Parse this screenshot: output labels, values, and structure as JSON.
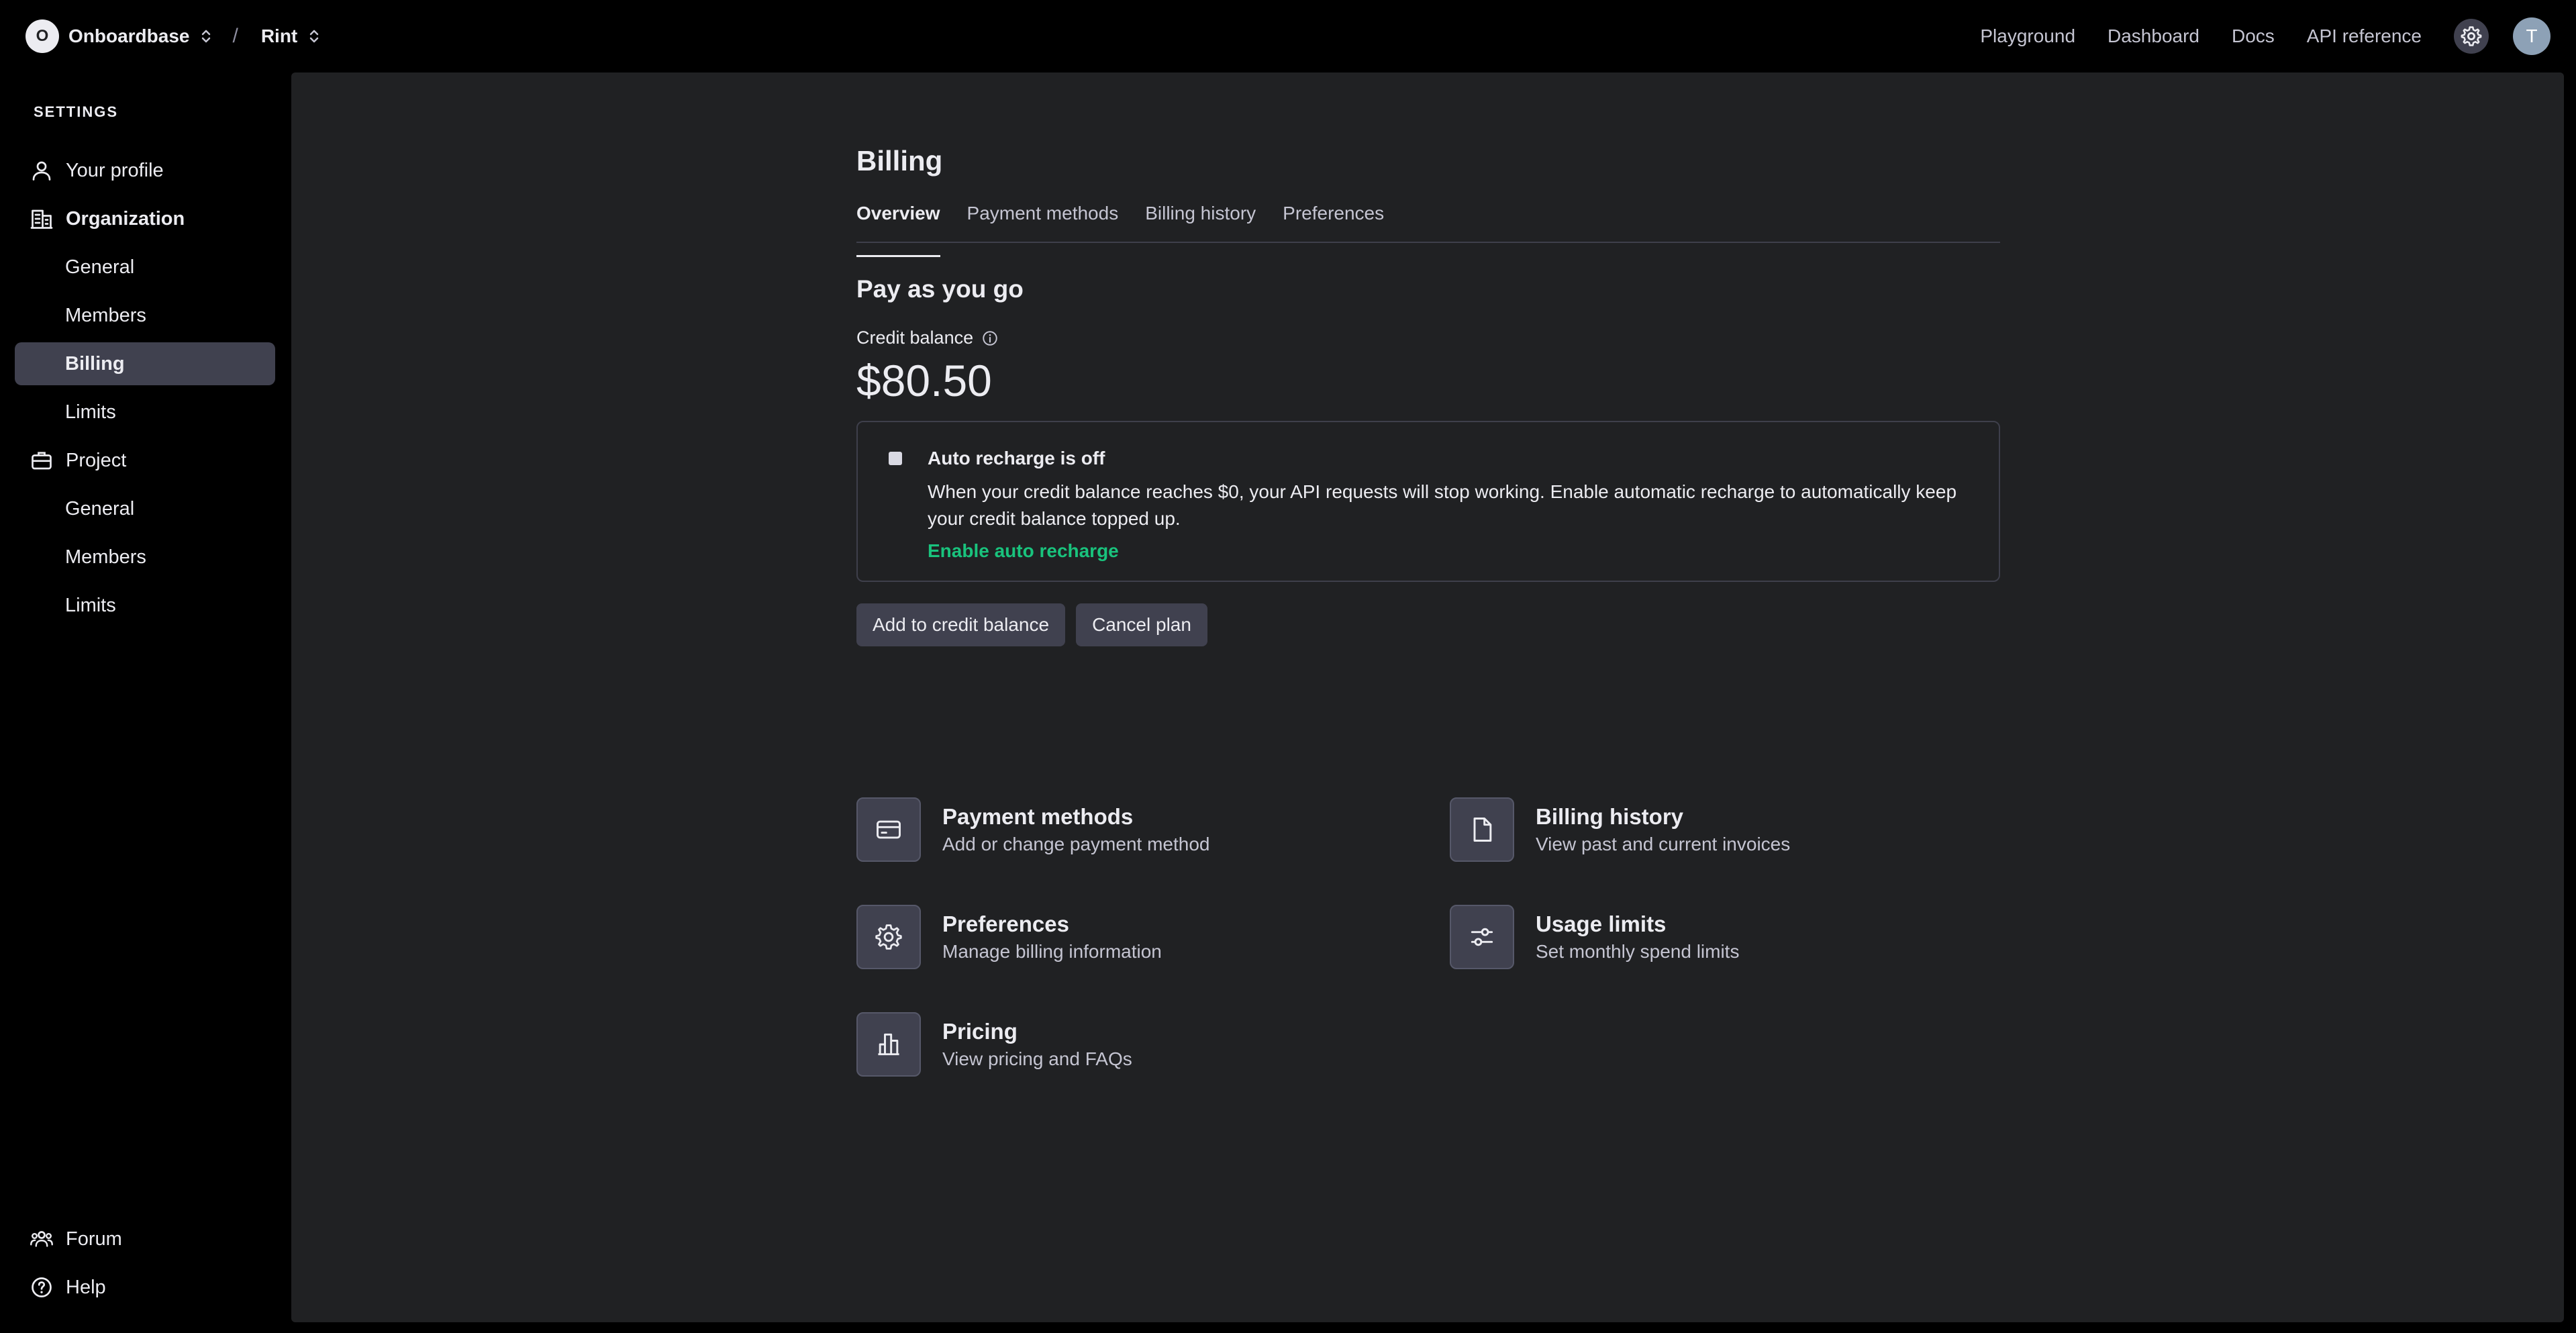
{
  "topbar": {
    "org_initial": "O",
    "org_name": "Onboardbase",
    "separator": "/",
    "project_name": "Rint",
    "nav": [
      "Playground",
      "Dashboard",
      "Docs",
      "API reference"
    ],
    "user_initial": "T"
  },
  "sidebar": {
    "heading": "SETTINGS",
    "your_profile": "Your profile",
    "organization": "Organization",
    "org_items": [
      "General",
      "Members",
      "Billing",
      "Limits"
    ],
    "project": "Project",
    "project_items": [
      "General",
      "Members",
      "Limits"
    ],
    "forum": "Forum",
    "help": "Help"
  },
  "main": {
    "title": "Billing",
    "tabs": [
      "Overview",
      "Payment methods",
      "Billing history",
      "Preferences"
    ],
    "plan_title": "Pay as you go",
    "balance_label": "Credit balance",
    "balance_value": "$80.50",
    "recharge": {
      "title": "Auto recharge is off",
      "text": "When your credit balance reaches $0, your API requests will stop working. Enable automatic recharge to automatically keep your credit balance topped up.",
      "link": "Enable auto recharge"
    },
    "buttons": {
      "add_credit": "Add to credit balance",
      "cancel_plan": "Cancel plan"
    },
    "cards": [
      {
        "title": "Payment methods",
        "subtitle": "Add or change payment method",
        "icon": "credit-card-icon"
      },
      {
        "title": "Billing history",
        "subtitle": "View past and current invoices",
        "icon": "document-icon"
      },
      {
        "title": "Preferences",
        "subtitle": "Manage billing information",
        "icon": "gear-icon"
      },
      {
        "title": "Usage limits",
        "subtitle": "Set monthly spend limits",
        "icon": "sliders-icon"
      },
      {
        "title": "Pricing",
        "subtitle": "View pricing and FAQs",
        "icon": "bar-chart-icon"
      }
    ]
  },
  "colors": {
    "background": "#000000",
    "panel": "#202123",
    "active_item": "#40414f",
    "accent_link": "#19c37d"
  }
}
